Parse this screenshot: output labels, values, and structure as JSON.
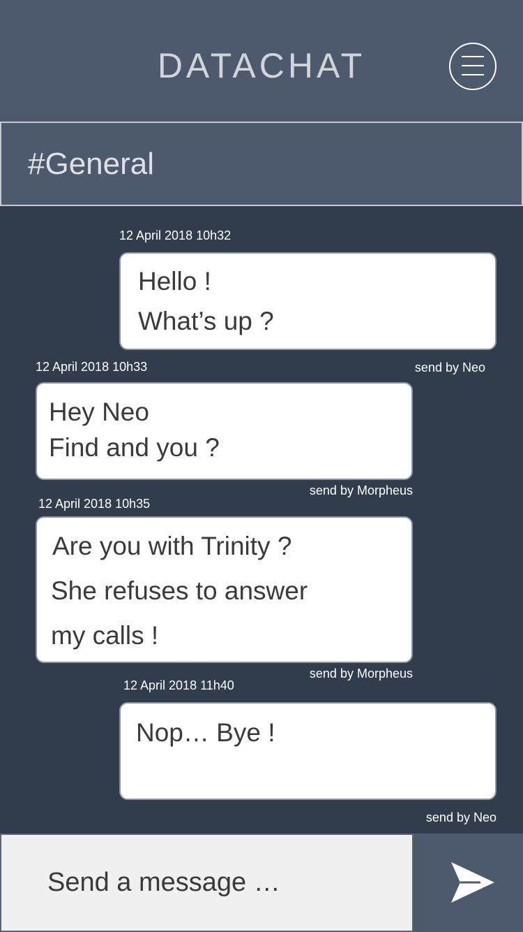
{
  "header": {
    "title": "DATACHAT",
    "menu_icon": "hamburger-menu-icon"
  },
  "channel": {
    "name": "#General"
  },
  "messages": [
    {
      "timestamp": "12 April 2018 10h32",
      "lines": [
        "Hello !",
        "What’s up ?"
      ],
      "sender": "send by Neo",
      "side": "right"
    },
    {
      "timestamp": "12 April 2018 10h33",
      "lines": [
        "Hey Neo",
        "Find and you ?"
      ],
      "sender": "send by Morpheus",
      "side": "left"
    },
    {
      "timestamp": "12 April 2018 10h35",
      "lines": [
        "Are you with Trinity ?",
        "She refuses to answer",
        "my calls !"
      ],
      "sender": "send by Morpheus",
      "side": "left"
    },
    {
      "timestamp": "12 April 2018 11h40",
      "lines": [
        "Nop… Bye !"
      ],
      "sender": "send by Neo",
      "side": "right"
    }
  ],
  "composer": {
    "placeholder": "Send a message …",
    "value": "",
    "send_icon": "paper-plane-send-icon"
  },
  "colors": {
    "header_bg": "#4d596d",
    "chat_bg": "#313c4d",
    "bubble_bg": "#ffffff",
    "input_bg": "#f0f0f0"
  }
}
